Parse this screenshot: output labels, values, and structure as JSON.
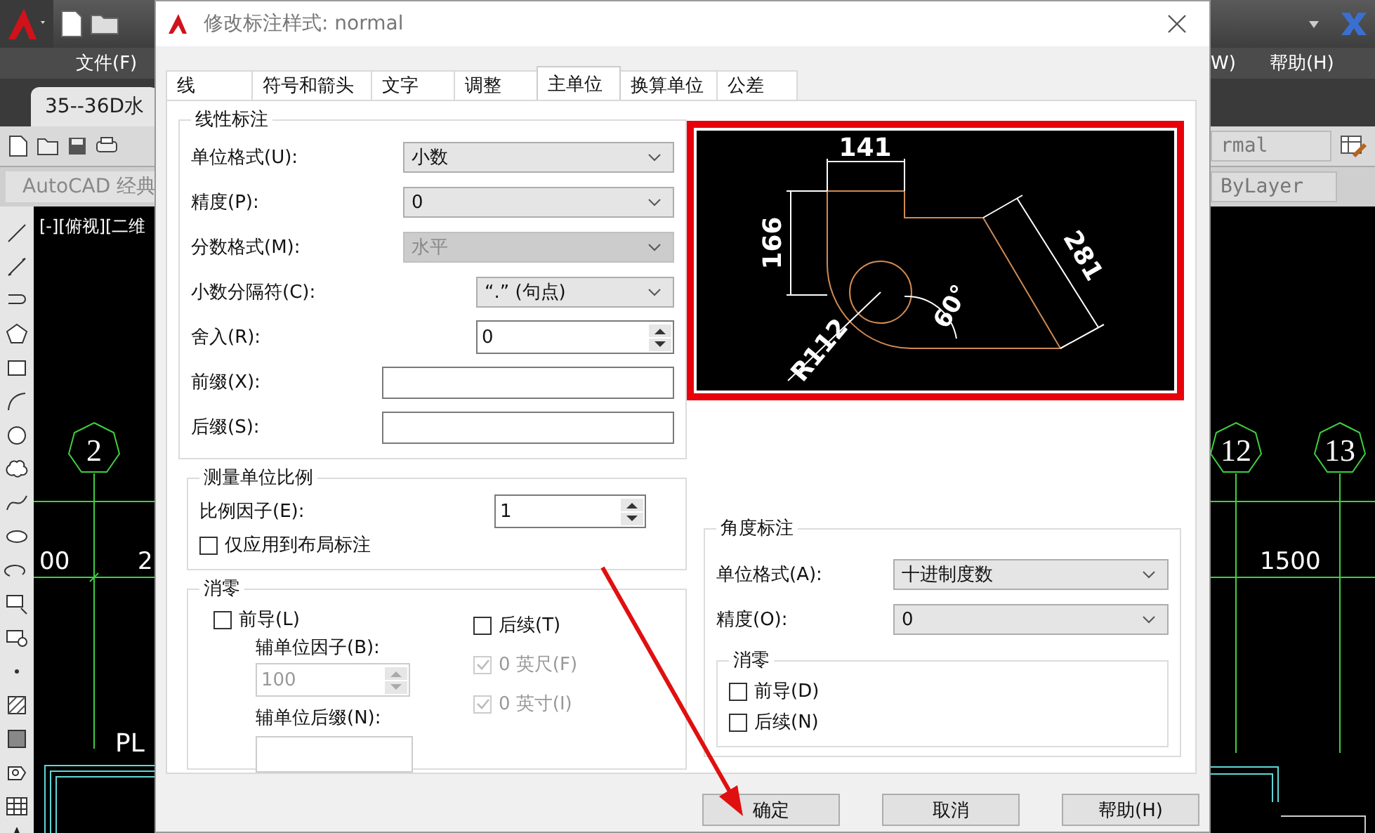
{
  "cad": {
    "left": {
      "menu_item": "文件(F)",
      "doc_tab": "35--36D水",
      "workspace": "AutoCAD 经典",
      "viewport_label": "[-][俯视][二维",
      "axis_bubble": "2",
      "dim_texts": [
        "00",
        "2"
      ],
      "text_fragment": "PL"
    },
    "right": {
      "menu_items": [
        "W)",
        "帮助(H)"
      ],
      "style_field": "rmal",
      "layer_field": "ByLayer",
      "axis_bubbles": [
        "12",
        "13"
      ],
      "dim_text": "1500"
    }
  },
  "dialog": {
    "title": "修改标注样式: normal",
    "tabs": [
      {
        "label": "线",
        "selected": false
      },
      {
        "label": "符号和箭头",
        "selected": false
      },
      {
        "label": "文字",
        "selected": false
      },
      {
        "label": "调整",
        "selected": false
      },
      {
        "label": "主单位",
        "selected": true
      },
      {
        "label": "换算单位",
        "selected": false
      },
      {
        "label": "公差",
        "selected": false
      }
    ],
    "linear": {
      "title": "线性标注",
      "rows": [
        {
          "kind": "select",
          "label": "单位格式(U):",
          "value": "小数",
          "disabled": false
        },
        {
          "kind": "select",
          "label": "精度(P):",
          "value": "0",
          "disabled": false
        },
        {
          "kind": "select",
          "label": "分数格式(M):",
          "value": "水平",
          "disabled": true
        },
        {
          "kind": "select",
          "label": "小数分隔符(C):",
          "value": "“.” (句点)",
          "disabled": false
        },
        {
          "kind": "spinner",
          "label": "舍入(R):",
          "value": "0",
          "disabled": false
        },
        {
          "kind": "input",
          "label": "前缀(X):",
          "disabled": false
        },
        {
          "kind": "input",
          "label": "后缀(S):",
          "disabled": false
        }
      ]
    },
    "scale": {
      "title": "测量单位比例",
      "factor": {
        "label": "比例因子(E):",
        "value": "1"
      },
      "layout_only": {
        "label": "仅应用到布局标注",
        "checked": false
      }
    },
    "zero": {
      "title": "消零",
      "leading": {
        "label": "前导(L)",
        "checked": false,
        "disabled": false
      },
      "sub_factor": {
        "label": "辅单位因子(B):",
        "value": "100",
        "disabled": true
      },
      "sub_suffix": {
        "label": "辅单位后缀(N):"
      },
      "trailing": {
        "label": "后续(T)",
        "checked": false,
        "disabled": false
      },
      "feet": {
        "label": "0 英尺(F)",
        "checked": true,
        "disabled": true
      },
      "inches": {
        "label": "0 英寸(I)",
        "checked": true,
        "disabled": true
      }
    },
    "preview": {
      "labels": [
        "141",
        "166",
        "281",
        "R112",
        "60°"
      ]
    },
    "angular": {
      "title": "角度标注",
      "unit_format": {
        "label": "单位格式(A):",
        "value": "十进制度数"
      },
      "precision": {
        "label": "精度(O):",
        "value": "0"
      },
      "zero": {
        "title": "消零",
        "items": [
          {
            "label": "前导(D)",
            "checked": false,
            "disabled": false
          },
          {
            "label": "后续(N)",
            "checked": false,
            "disabled": false
          }
        ]
      }
    },
    "buttons": [
      "确定",
      "取消",
      "帮助(H)"
    ]
  }
}
